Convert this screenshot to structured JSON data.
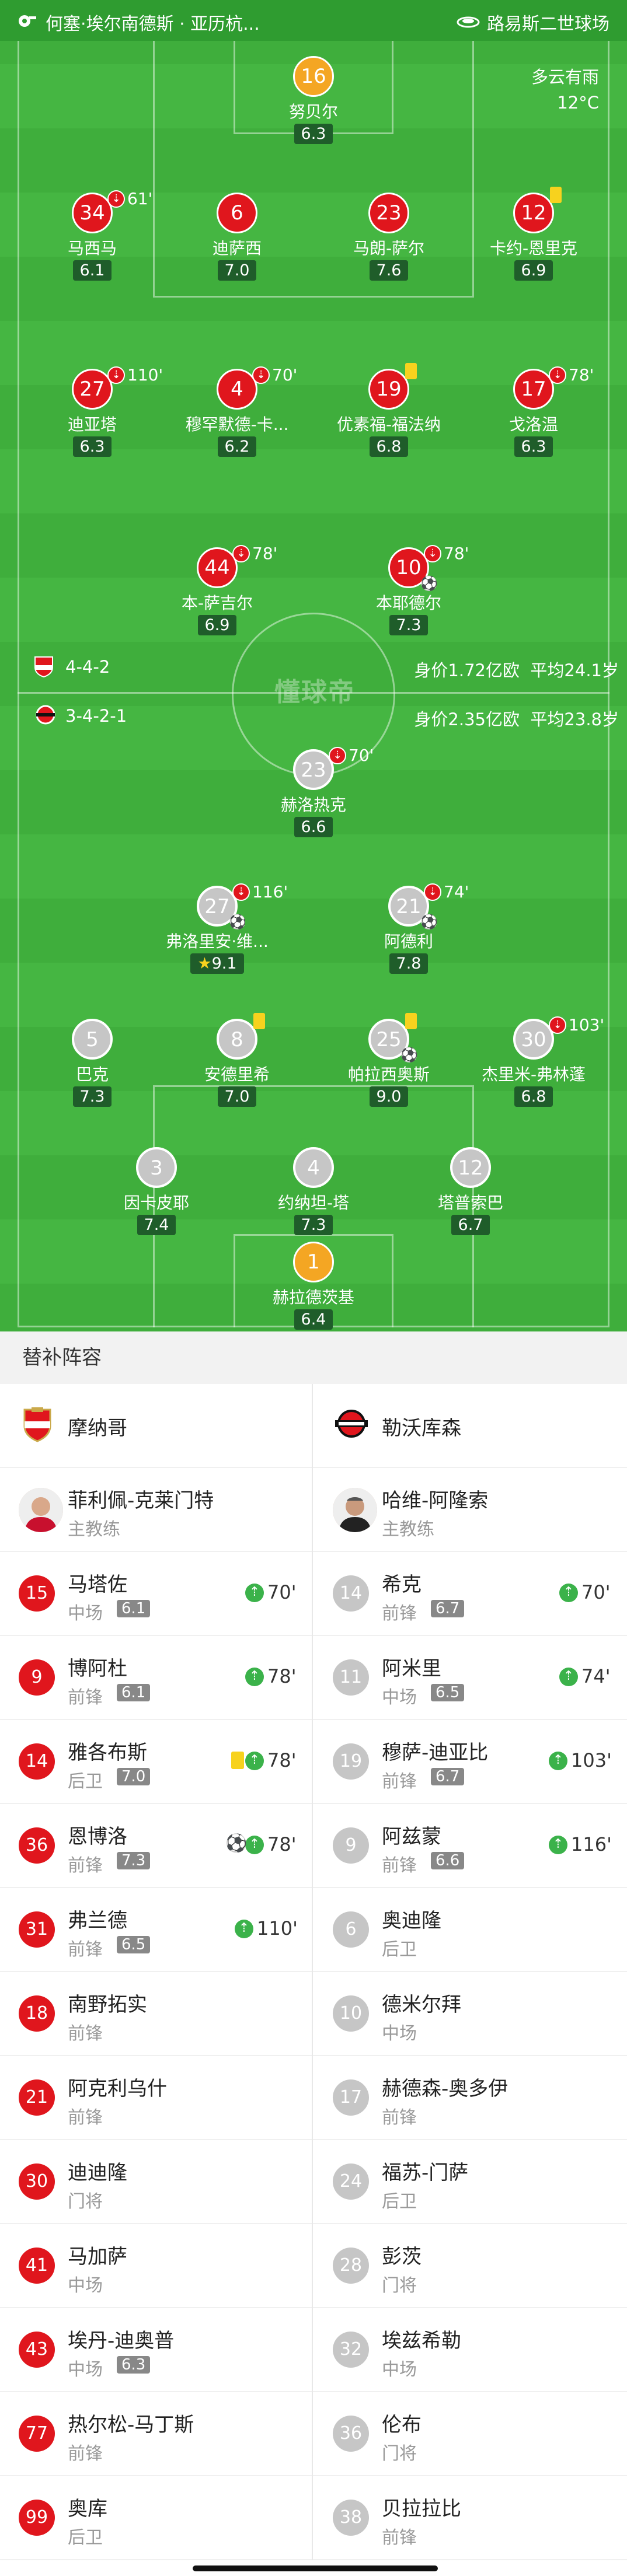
{
  "header": {
    "match_title": "何塞·埃尔南德斯 · 亚历杭...",
    "stadium": "路易斯二世球场"
  },
  "weather": {
    "condition": "多云有雨",
    "temp": "12°C"
  },
  "home_team": {
    "formation": "4-4-2",
    "value": "身价1.72亿欧",
    "age": "平均24.1岁"
  },
  "away_team": {
    "formation": "3-4-2-1",
    "value": "身价2.35亿欧",
    "age": "平均23.8岁"
  },
  "watermark": "懂球帝",
  "pitch_players": [
    {
      "num": "16",
      "name": "努贝尔",
      "rating": "6.3",
      "side": "gk"
    },
    {
      "num": "34",
      "name": "马西马",
      "rating": "6.1",
      "side": "home",
      "sub": "61'"
    },
    {
      "num": "6",
      "name": "迪萨西",
      "rating": "7.0",
      "side": "home"
    },
    {
      "num": "23",
      "name": "马朗-萨尔",
      "rating": "7.6",
      "side": "home"
    },
    {
      "num": "12",
      "name": "卡约-恩里克",
      "rating": "6.9",
      "side": "home",
      "yellow": true
    },
    {
      "num": "27",
      "name": "迪亚塔",
      "rating": "6.3",
      "side": "home",
      "sub": "110'"
    },
    {
      "num": "4",
      "name": "穆罕默德-卡...",
      "rating": "6.2",
      "side": "home",
      "sub": "70'"
    },
    {
      "num": "19",
      "name": "优素福-福法纳",
      "rating": "6.8",
      "side": "home",
      "yellow": true
    },
    {
      "num": "17",
      "name": "戈洛温",
      "rating": "6.3",
      "side": "home",
      "sub": "78'"
    },
    {
      "num": "44",
      "name": "本-萨吉尔",
      "rating": "6.9",
      "side": "home",
      "sub": "78'"
    },
    {
      "num": "10",
      "name": "本耶德尔",
      "rating": "7.3",
      "side": "home",
      "sub": "78'",
      "goal": true
    },
    {
      "num": "23",
      "name": "赫洛热克",
      "rating": "6.6",
      "side": "away",
      "sub": "70'"
    },
    {
      "num": "27",
      "name": "弗洛里安·维...",
      "rating": "9.1",
      "side": "away",
      "sub": "116'",
      "goal": true,
      "star": true
    },
    {
      "num": "21",
      "name": "阿德利",
      "rating": "7.8",
      "side": "away",
      "sub": "74'",
      "goal": true
    },
    {
      "num": "5",
      "name": "巴克",
      "rating": "7.3",
      "side": "away"
    },
    {
      "num": "8",
      "name": "安德里希",
      "rating": "7.0",
      "side": "away",
      "yellow": true
    },
    {
      "num": "25",
      "name": "帕拉西奥斯",
      "rating": "9.0",
      "side": "away",
      "yellow": true,
      "goal": true
    },
    {
      "num": "30",
      "name": "杰里米-弗林蓬",
      "rating": "6.8",
      "side": "away",
      "sub": "103'"
    },
    {
      "num": "3",
      "name": "因卡皮耶",
      "rating": "7.4",
      "side": "away"
    },
    {
      "num": "4",
      "name": "约纳坦-塔",
      "rating": "7.3",
      "side": "away"
    },
    {
      "num": "12",
      "name": "塔普索巴",
      "rating": "6.7",
      "side": "away"
    },
    {
      "num": "1",
      "name": "赫拉德茨基",
      "rating": "6.4",
      "side": "gk"
    }
  ],
  "subs_title": "替补阵容",
  "teams": {
    "home": "摩纳哥",
    "away": "勒沃库森"
  },
  "coaches": {
    "home": "菲利佩-克莱门特",
    "away": "哈维-阿隆索",
    "role": "主教练"
  },
  "subs_home": [
    {
      "num": "15",
      "name": "马塔佐",
      "pos": "中场",
      "rating": "6.1",
      "time": "70'"
    },
    {
      "num": "9",
      "name": "博阿杜",
      "pos": "前锋",
      "rating": "6.1",
      "time": "78'"
    },
    {
      "num": "14",
      "name": "雅各布斯",
      "pos": "后卫",
      "rating": "7.0",
      "time": "78'",
      "yellow": true
    },
    {
      "num": "36",
      "name": "恩博洛",
      "pos": "前锋",
      "rating": "7.3",
      "time": "78'",
      "goal": true
    },
    {
      "num": "31",
      "name": "弗兰德",
      "pos": "前锋",
      "rating": "6.5",
      "time": "110'"
    },
    {
      "num": "18",
      "name": "南野拓实",
      "pos": "前锋"
    },
    {
      "num": "21",
      "name": "阿克利乌什",
      "pos": "前锋"
    },
    {
      "num": "30",
      "name": "迪迪隆",
      "pos": "门将"
    },
    {
      "num": "41",
      "name": "马加萨",
      "pos": "中场"
    },
    {
      "num": "43",
      "name": "埃丹-迪奥普",
      "pos": "中场",
      "rating": "6.3"
    },
    {
      "num": "77",
      "name": "热尔松-马丁斯",
      "pos": "前锋"
    },
    {
      "num": "99",
      "name": "奥库",
      "pos": "后卫"
    }
  ],
  "subs_away": [
    {
      "num": "14",
      "name": "希克",
      "pos": "前锋",
      "rating": "6.7",
      "time": "70'"
    },
    {
      "num": "11",
      "name": "阿米里",
      "pos": "中场",
      "rating": "6.5",
      "time": "74'"
    },
    {
      "num": "19",
      "name": "穆萨-迪亚比",
      "pos": "前锋",
      "rating": "6.7",
      "time": "103'"
    },
    {
      "num": "9",
      "name": "阿兹蒙",
      "pos": "前锋",
      "rating": "6.6",
      "time": "116'"
    },
    {
      "num": "6",
      "name": "奥迪隆",
      "pos": "后卫"
    },
    {
      "num": "10",
      "name": "德米尔拜",
      "pos": "中场"
    },
    {
      "num": "17",
      "name": "赫德森-奥多伊",
      "pos": "前锋"
    },
    {
      "num": "24",
      "name": "福苏-门萨",
      "pos": "后卫"
    },
    {
      "num": "28",
      "name": "彭茨",
      "pos": "门将"
    },
    {
      "num": "32",
      "name": "埃兹希勒",
      "pos": "中场"
    },
    {
      "num": "36",
      "name": "伦布",
      "pos": "门将"
    },
    {
      "num": "38",
      "name": "贝拉拉比",
      "pos": "前锋"
    }
  ],
  "colors": {
    "home": "#e0161d",
    "away": "#c6c6c6",
    "pitch": "#3fae3c",
    "goalkeeper": "#f4a623"
  }
}
